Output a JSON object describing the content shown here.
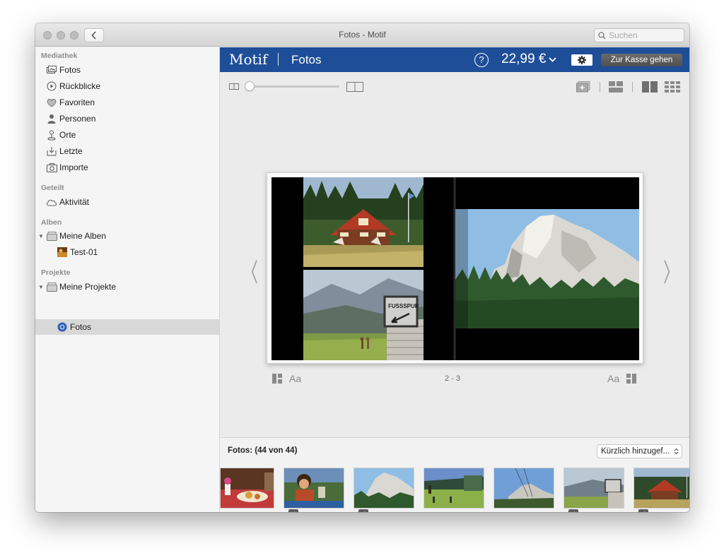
{
  "window": {
    "title": "Fotos - Motif"
  },
  "search": {
    "placeholder": "Suchen"
  },
  "sidebar": {
    "sections": [
      {
        "title": "Mediathek",
        "items": [
          {
            "label": "Fotos",
            "icon": "photos-icon"
          },
          {
            "label": "Rückblicke",
            "icon": "memories-icon"
          },
          {
            "label": "Favoriten",
            "icon": "heart-icon"
          },
          {
            "label": "Personen",
            "icon": "person-icon"
          },
          {
            "label": "Orte",
            "icon": "pin-icon"
          },
          {
            "label": "Letzte",
            "icon": "import-tray-icon"
          },
          {
            "label": "Importe",
            "icon": "camera-icon"
          }
        ]
      },
      {
        "title": "Geteilt",
        "items": [
          {
            "label": "Aktivität",
            "icon": "cloud-icon"
          }
        ]
      },
      {
        "title": "Alben",
        "items": [
          {
            "label": "Meine Alben",
            "icon": "folder-icon"
          },
          {
            "label": "Test-01",
            "icon": "album-thumb-icon"
          }
        ]
      },
      {
        "title": "Projekte",
        "items": [
          {
            "label": "Meine Projekte",
            "icon": "folder-icon"
          },
          {
            "label": "Fotos",
            "icon": "motif-project-icon",
            "selected": true
          }
        ]
      }
    ]
  },
  "header": {
    "brand": "Motif",
    "separator": "|",
    "project": "Fotos",
    "help": "?",
    "price": "22,99 €",
    "checkout_label": "Zur Kasse gehen",
    "bar_color": "#1e4e98"
  },
  "editor": {
    "page_label": "2 - 3",
    "text_style_left": "Aa",
    "text_style_right": "Aa",
    "zoom_level": 0.0
  },
  "photos_panel": {
    "count_label": "Fotos: (44 von 44)",
    "sort_label": "Kürzlich hinzugef...",
    "thumbnails": [
      {
        "subject": "food-table",
        "checked": false
      },
      {
        "subject": "woman-drinking",
        "checked": true
      },
      {
        "subject": "rock-peak",
        "checked": true
      },
      {
        "subject": "meadow-hikers",
        "checked": false
      },
      {
        "subject": "cable-mountain",
        "checked": false
      },
      {
        "subject": "fusspur-sign",
        "checked": true
      },
      {
        "subject": "alpine-hut",
        "checked": true
      }
    ]
  },
  "colors": {
    "accent": "#1e4e98",
    "selected_row": "#d8d8d8"
  }
}
